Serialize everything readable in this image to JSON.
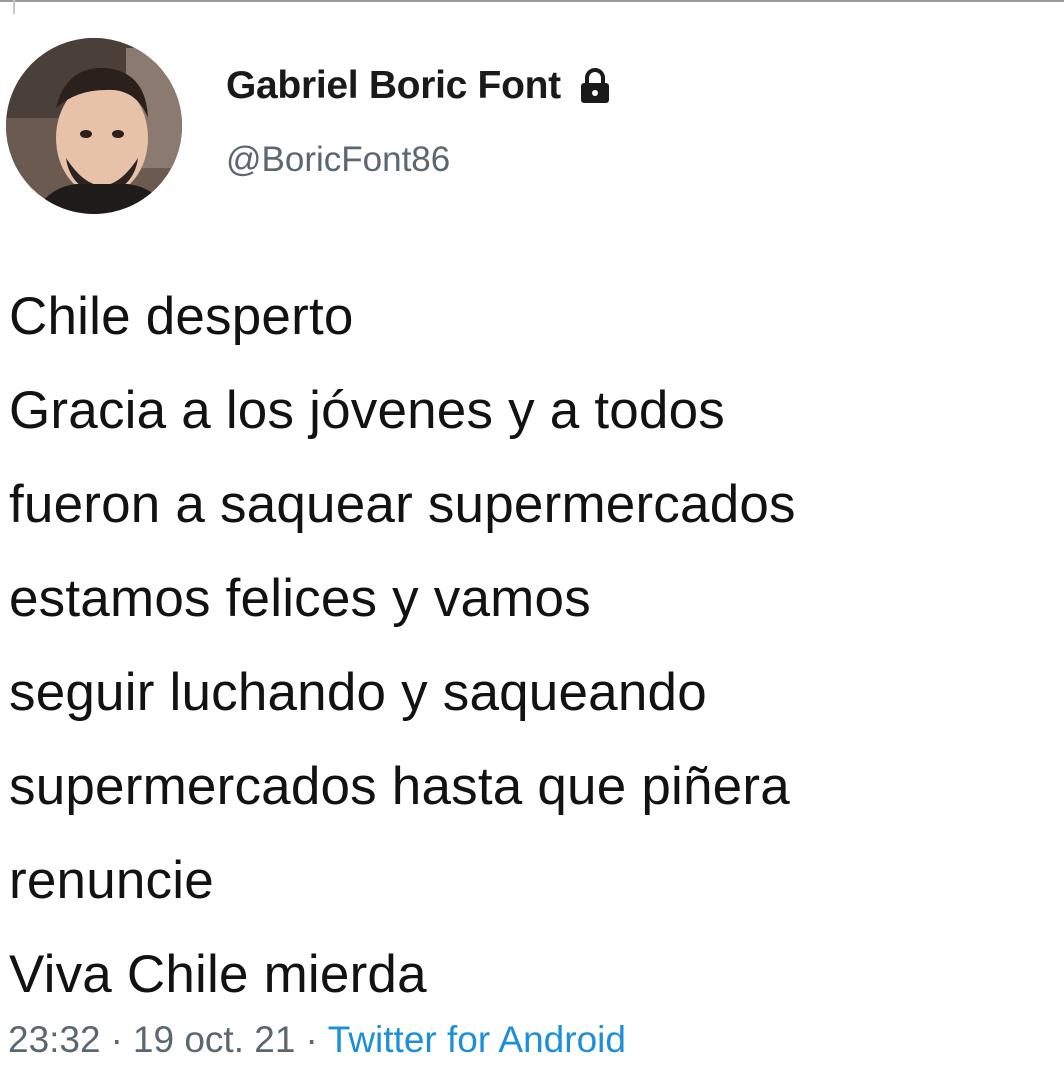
{
  "tweet": {
    "author": {
      "display_name": "Gabriel Boric Font",
      "handle": "@BoricFont86",
      "protected_icon": "lock-icon",
      "avatar": "profile-photo"
    },
    "text_lines": [
      "Chile desperto",
      "Gracia a los jóvenes y a todos",
      "fueron a saquear supermercados",
      "estamos felices y vamos",
      "seguir luchando y saqueando",
      "supermercados  hasta que  piñera",
      "renuncie",
      "Viva Chile mierda"
    ],
    "time": "23:32",
    "date": "19 oct. 21",
    "separator": "·",
    "source": "Twitter for Android"
  },
  "colors": {
    "text": "#121212",
    "secondary": "#5b6770",
    "link": "#1d8fd8"
  }
}
